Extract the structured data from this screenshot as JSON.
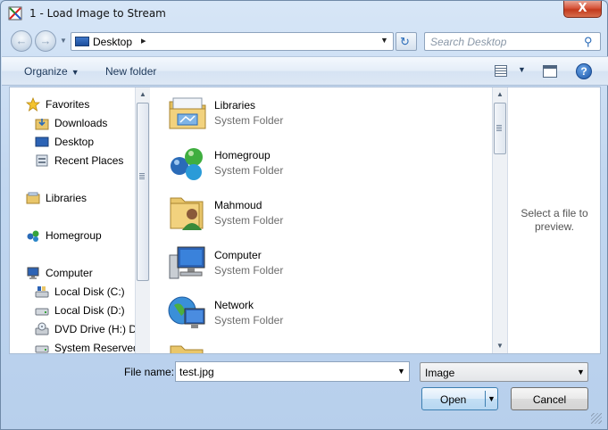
{
  "window": {
    "title": "1 - Load Image to Stream",
    "close_label": "X"
  },
  "nav": {
    "address_crumb": "Desktop",
    "search_placeholder": "Search Desktop"
  },
  "toolbar": {
    "organize_label": "Organize",
    "new_folder_label": "New folder",
    "help_label": "?"
  },
  "sidebar": {
    "items": [
      {
        "label": "Favorites",
        "icon": "star-icon"
      },
      {
        "label": "Downloads",
        "icon": "downloads-folder-icon"
      },
      {
        "label": "Desktop",
        "icon": "desktop-icon"
      },
      {
        "label": "Recent Places",
        "icon": "recent-places-icon"
      },
      {
        "label": "Libraries",
        "icon": "libraries-icon"
      },
      {
        "label": "Homegroup",
        "icon": "homegroup-icon"
      },
      {
        "label": "Computer",
        "icon": "computer-icon"
      },
      {
        "label": "Local Disk (C:)",
        "icon": "drive-c-icon"
      },
      {
        "label": "Local Disk (D:)",
        "icon": "drive-icon"
      },
      {
        "label": "DVD Drive (H:) D\\",
        "icon": "dvd-drive-icon"
      },
      {
        "label": "System Reserved",
        "icon": "drive-icon"
      }
    ]
  },
  "files": [
    {
      "name": "Libraries",
      "type": "System Folder",
      "icon": "libraries-folder-icon"
    },
    {
      "name": "Homegroup",
      "type": "System Folder",
      "icon": "homegroup-icon"
    },
    {
      "name": "Mahmoud",
      "type": "System Folder",
      "icon": "user-folder-icon"
    },
    {
      "name": "Computer",
      "type": "System Folder",
      "icon": "computer-icon"
    },
    {
      "name": "Network",
      "type": "System Folder",
      "icon": "network-icon"
    }
  ],
  "preview": {
    "line1": "Select a file to",
    "line2": "preview."
  },
  "footer": {
    "file_name_label": "File name:",
    "file_name_value": "test.jpg",
    "filter_value": "Image",
    "open_label": "Open",
    "cancel_label": "Cancel"
  }
}
